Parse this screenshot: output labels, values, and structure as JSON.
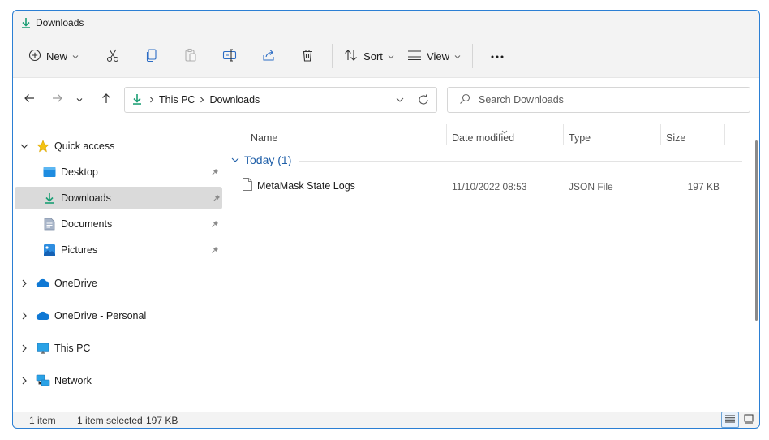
{
  "window": {
    "title": "Downloads",
    "accent_color": "#2b7fd4",
    "title_icon": "download-arrow-icon"
  },
  "commandbar": {
    "new_label": "New",
    "sort_label": "Sort",
    "view_label": "View",
    "icons": [
      "add-circle-icon",
      "cut-icon",
      "copy-icon",
      "paste-icon",
      "rename-icon",
      "share-icon",
      "delete-icon",
      "sort-icon",
      "view-icon",
      "more-icon"
    ]
  },
  "address": {
    "crumbs": [
      "This PC",
      "Downloads"
    ],
    "search_placeholder": "Search Downloads"
  },
  "sidebar": {
    "quick_access": "Quick access",
    "items": [
      {
        "label": "Desktop",
        "icon": "desktop-folder-icon",
        "pinned": true
      },
      {
        "label": "Downloads",
        "icon": "download-arrow-icon",
        "pinned": true,
        "selected": true
      },
      {
        "label": "Documents",
        "icon": "document-icon",
        "pinned": true
      },
      {
        "label": "Pictures",
        "icon": "picture-icon",
        "pinned": true
      }
    ],
    "roots": [
      {
        "label": "OneDrive",
        "icon": "cloud-icon"
      },
      {
        "label": "OneDrive - Personal",
        "icon": "cloud-icon"
      },
      {
        "label": "This PC",
        "icon": "monitor-icon"
      },
      {
        "label": "Network",
        "icon": "network-icon"
      }
    ]
  },
  "filelist": {
    "columns": [
      "Name",
      "Date modified",
      "Type",
      "Size"
    ],
    "group_label": "Today (1)",
    "files": [
      {
        "name": "MetaMask State Logs",
        "date": "11/10/2022 08:53",
        "type": "JSON File",
        "size": "197 KB"
      }
    ]
  },
  "statusbar": {
    "item_count": "1 item",
    "selected": "1 item selected",
    "selected_size": "197 KB"
  }
}
